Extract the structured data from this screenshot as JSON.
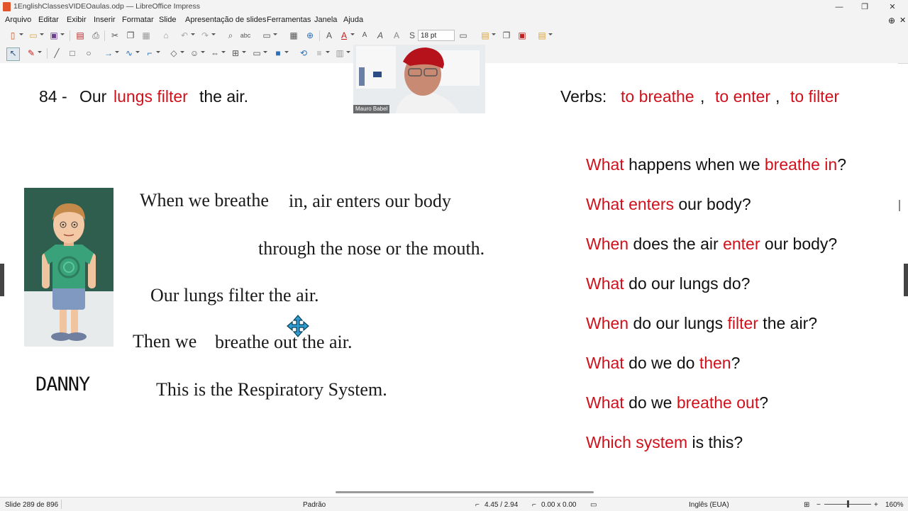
{
  "window": {
    "title": "1EnglishClassesVIDEOaulas.odp — LibreOffice Impress",
    "minimize": "—",
    "maximize": "❐",
    "close": "✕"
  },
  "menu": [
    "Arquivo",
    "Editar",
    "Exibir",
    "Inserir",
    "Formatar",
    "Slide",
    "Apresentação de slides",
    "Ferramentas",
    "Janela",
    "Ajuda"
  ],
  "toolbar": {
    "font_size": "18 pt",
    "shadow_label": "S"
  },
  "slide": {
    "header_left": {
      "num": "84 -",
      "w1": "Our",
      "w2": "lungs filter",
      "w3": "the air."
    },
    "verbs": {
      "label": "Verbs:",
      "v1": "to breathe",
      "v2": "to enter",
      "v3": "to filter",
      "comma": ","
    },
    "lines": {
      "l1a": "When we breathe",
      "l1b": "in, air enters our body",
      "l2": "through the nose or the mouth.",
      "l3": "Our lungs filter the air.",
      "l4a": "Then we",
      "l4b": "breathe out the air.",
      "l5": "This is the Respiratory System."
    },
    "character_name": "DANNY",
    "questions": [
      {
        "a": "What",
        "b": " happens when we ",
        "c": "breathe in",
        "d": "?"
      },
      {
        "a": "What enters",
        "b": " our body?"
      },
      {
        "a": "When",
        "b": " does the air ",
        "c": "enter",
        "d": " our body?"
      },
      {
        "a": "What",
        "b": " do our lungs do?"
      },
      {
        "a": "When",
        "b": " do our lungs ",
        "c": "filter",
        "d": " the air?"
      },
      {
        "a": "What",
        "b": " do we do ",
        "c": "then",
        "d": "?"
      },
      {
        "a": "What",
        "b": " do we ",
        "c": "breathe out",
        "d": "?"
      },
      {
        "a": "Which system",
        "b": " is this?"
      }
    ]
  },
  "webcam": {
    "name": "Mauro Babel"
  },
  "status": {
    "slide": "Slide 289 de 896",
    "layout": "Padrão",
    "position": "4.45 / 2.94",
    "size": "0.00 x 0.00",
    "language": "Inglês (EUA)",
    "zoom": "160%"
  },
  "colors": {
    "accent": "#d0111b",
    "chrome": "#f3f3f3"
  }
}
